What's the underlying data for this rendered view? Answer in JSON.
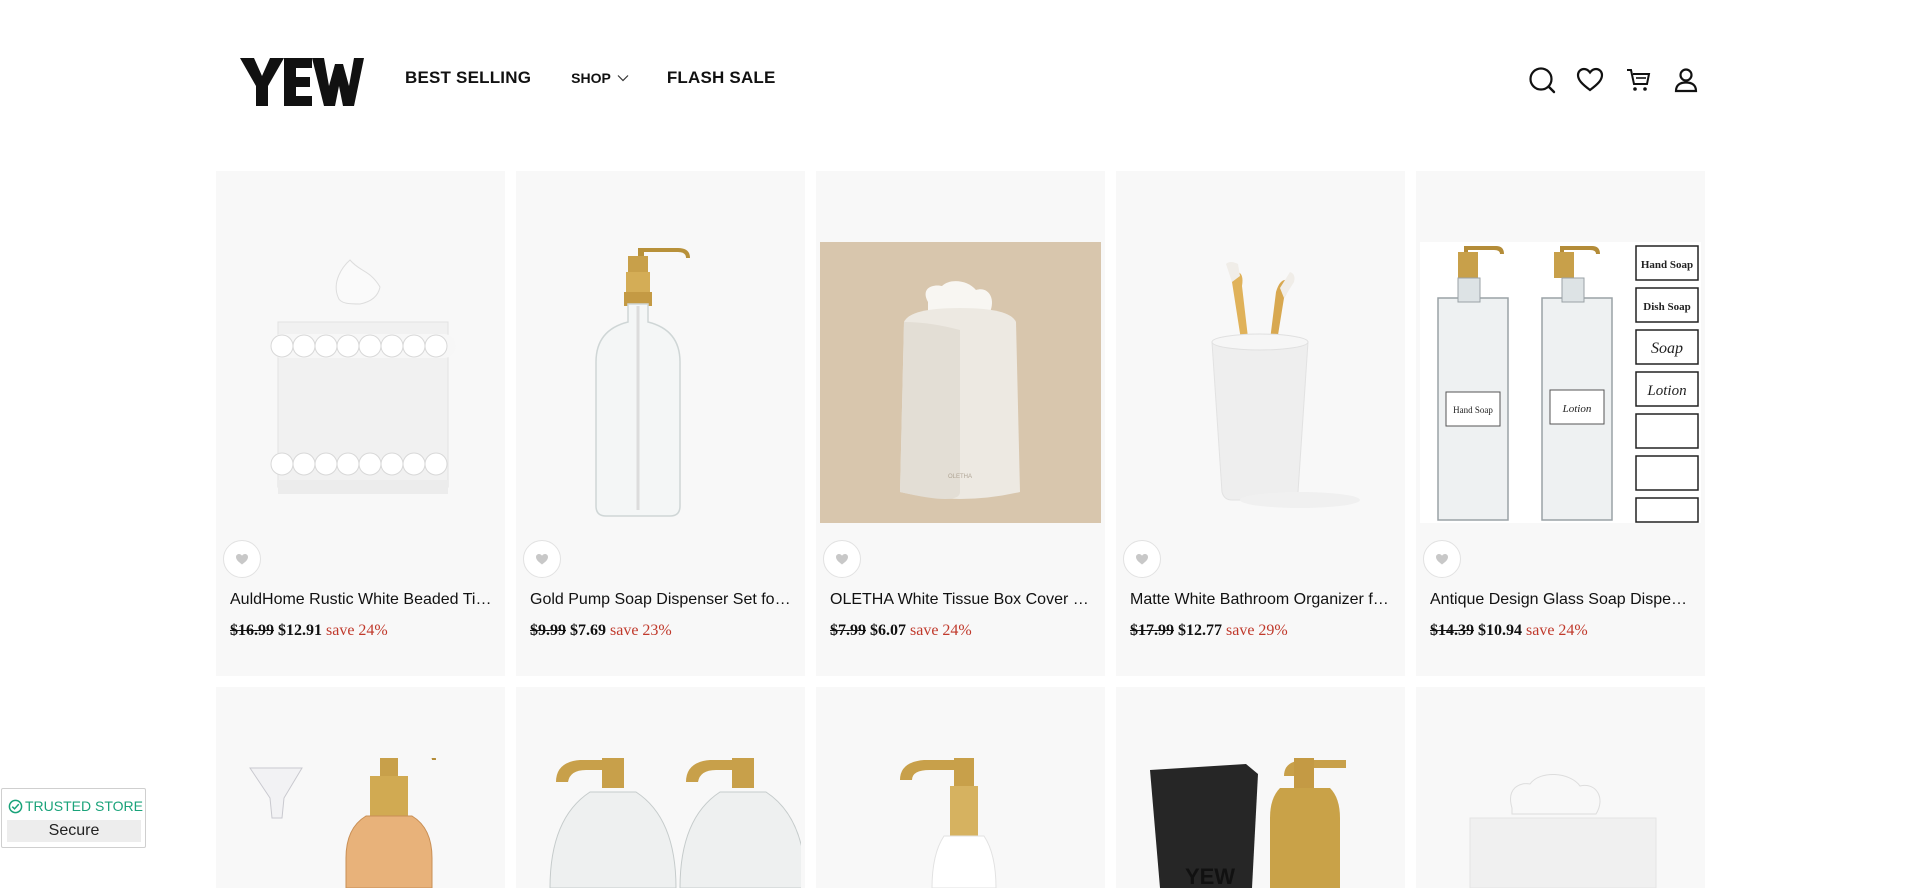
{
  "header": {
    "logo_text": "YEW",
    "nav": {
      "best_selling": "BEST SELLING",
      "shop": "SHOP",
      "flash_sale": "FLASH SALE"
    },
    "icons": [
      "search-icon",
      "heart-icon",
      "cart-icon",
      "account-icon"
    ]
  },
  "products": [
    {
      "title": "AuldHome Rustic White Beaded Tissue Box Cover",
      "old_price": "$16.99",
      "price": "$12.91",
      "save": "save 24%"
    },
    {
      "title": "Gold Pump Soap Dispenser Set for Bathroom",
      "old_price": "$9.99",
      "price": "$7.69",
      "save": "save 23%"
    },
    {
      "title": "OLETHA White Tissue Box Cover - Square",
      "old_price": "$7.99",
      "price": "$6.07",
      "save": "save 24%"
    },
    {
      "title": "Matte White Bathroom Organizer for Toothbrushes",
      "old_price": "$17.99",
      "price": "$12.77",
      "save": "save 29%"
    },
    {
      "title": "Antique Design Glass Soap Dispenser Set",
      "old_price": "$14.39",
      "price": "$10.94",
      "save": "save 24%"
    }
  ],
  "trusted_badge": {
    "title": "TRUSTED STORE",
    "subtitle": "Secure"
  },
  "colors": {
    "sale_red": "#c0392b",
    "trusted_green": "#1aa37a",
    "card_bg": "#f8f8f8"
  }
}
